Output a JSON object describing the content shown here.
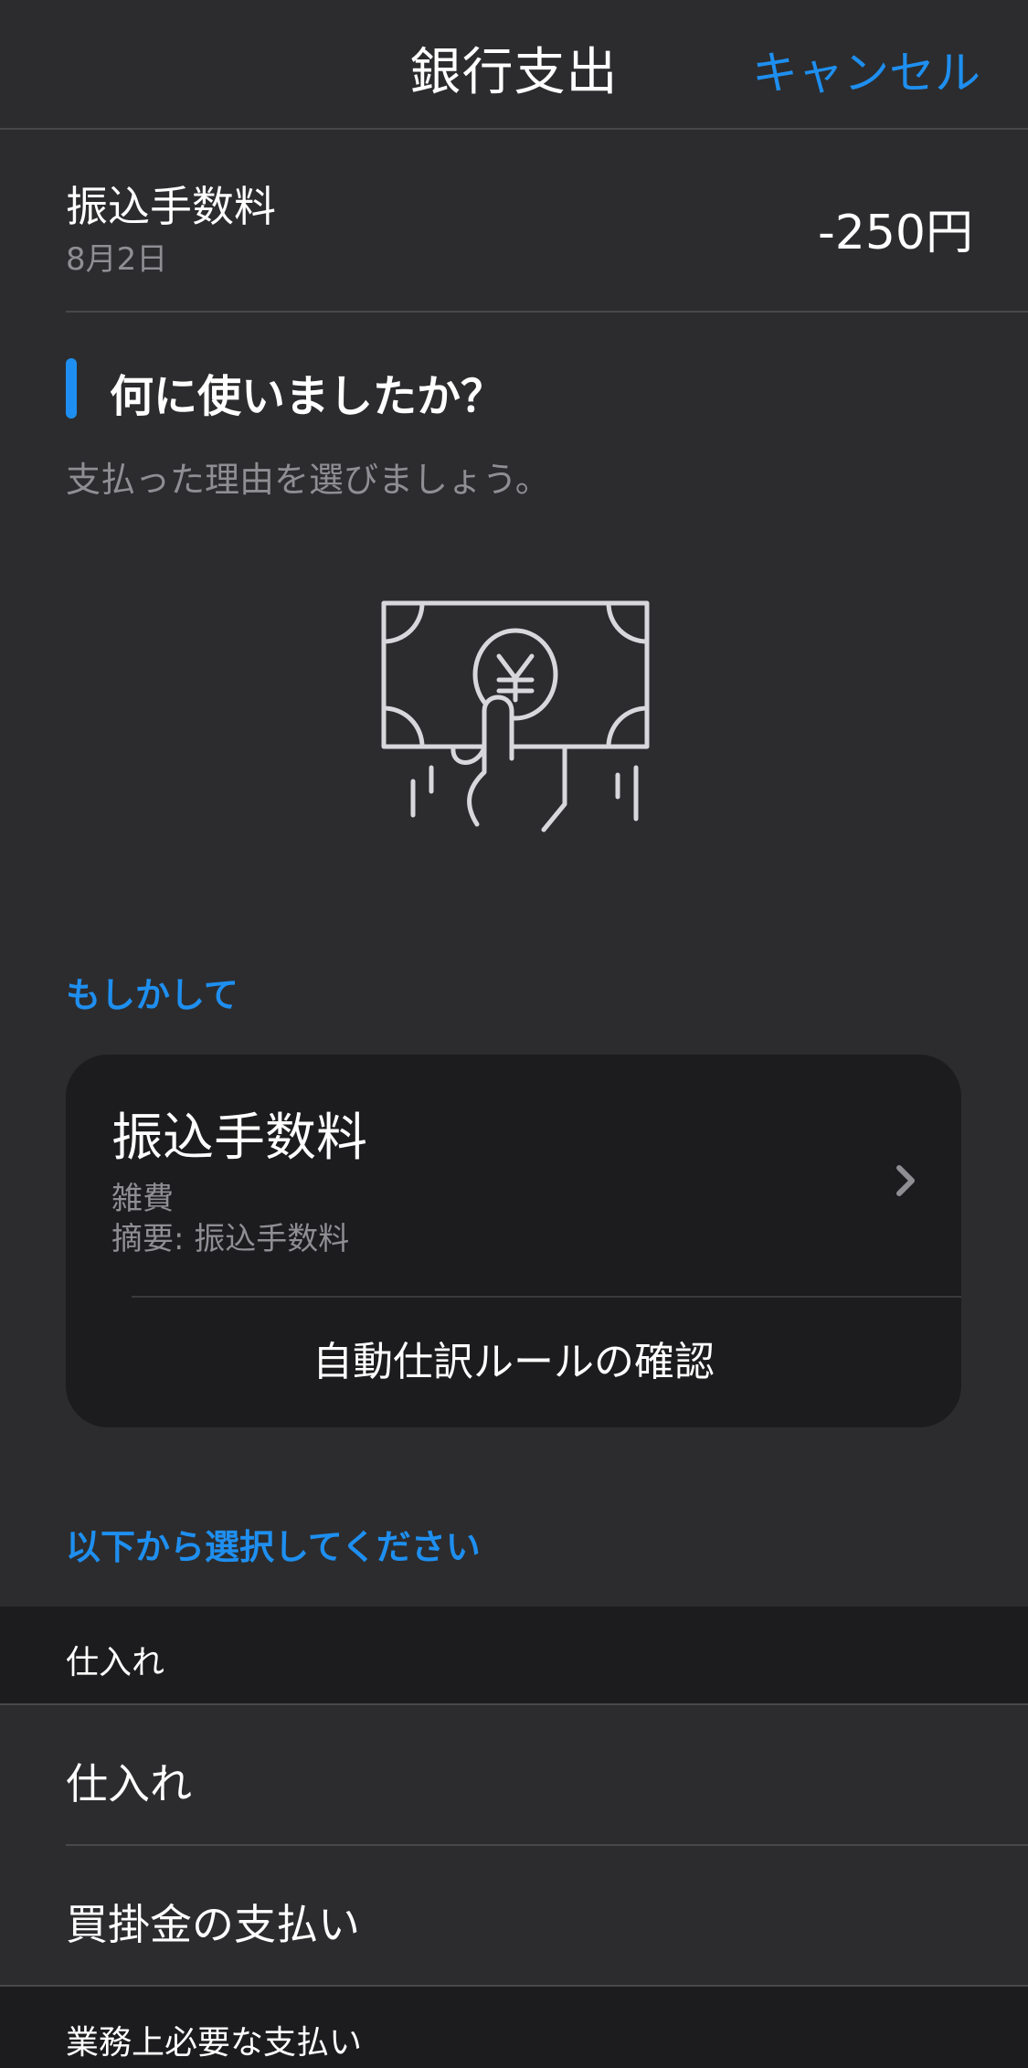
{
  "nav": {
    "title": "銀行支出",
    "cancel_label": "キャンセル"
  },
  "transaction": {
    "name": "振込手数料",
    "date": "8月2日",
    "amount": "-250円"
  },
  "question": {
    "title": "何に使いましたか？",
    "subtitle": "支払った理由を選びましょう。",
    "illustration_icon": "hand-holding-yen-bill-icon"
  },
  "suggestion": {
    "section_label": "もしかして",
    "card": {
      "title": "振込手数料",
      "category": "雑費",
      "memo": "摘要: 振込手数料",
      "rule_label": "自動仕訳ルールの確認"
    }
  },
  "select": {
    "section_label": "以下から選択してください",
    "groups": [
      {
        "header": "仕入れ",
        "items": [
          "仕入れ",
          "買掛金の支払い"
        ]
      },
      {
        "header": "業務上必要な支払い",
        "items": []
      }
    ]
  },
  "colors": {
    "accent": "#1e8ff0",
    "background": "#2c2c2e",
    "card": "#1c1c1e",
    "secondary_text": "#8e8e93"
  }
}
